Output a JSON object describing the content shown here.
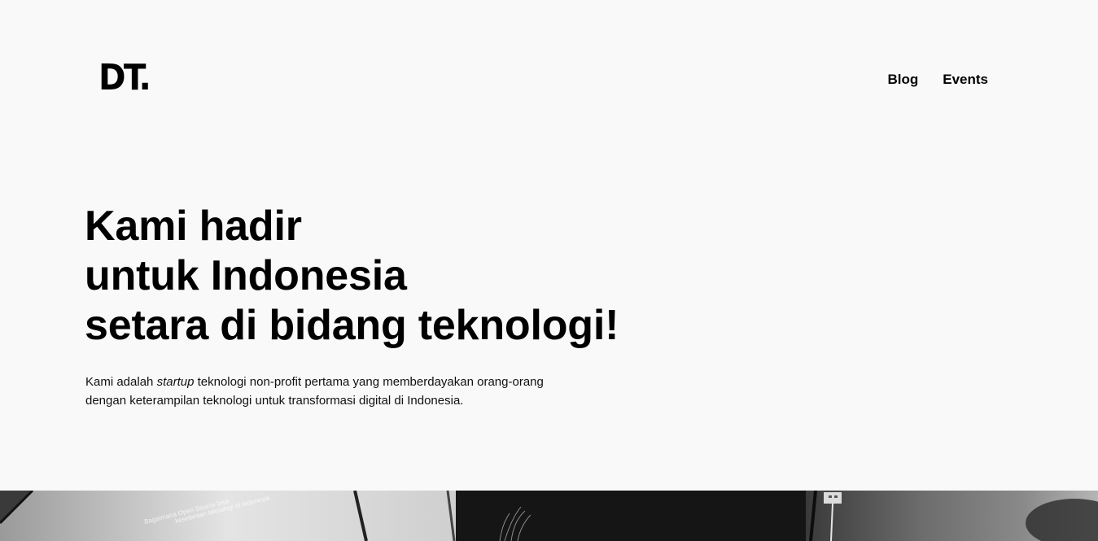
{
  "header": {
    "logo_text": "DT.",
    "nav": [
      {
        "label": "Blog"
      },
      {
        "label": "Events"
      }
    ]
  },
  "hero": {
    "title_lines": [
      "Kami hadir",
      "untuk Indonesia",
      "setara di bidang teknologi!"
    ],
    "description": {
      "part1": "Kami adalah ",
      "emphasis": "startup",
      "part2": " teknologi non-profit pertama yang memberdayakan orang-orang dengan keterampilan teknologi untuk transformasi digital di Indonesia."
    }
  },
  "photo": {
    "projected_text_1": "Bagaimana Open Source bisa",
    "projected_text_2": "kesetaraan teknologi di Indonesia"
  }
}
